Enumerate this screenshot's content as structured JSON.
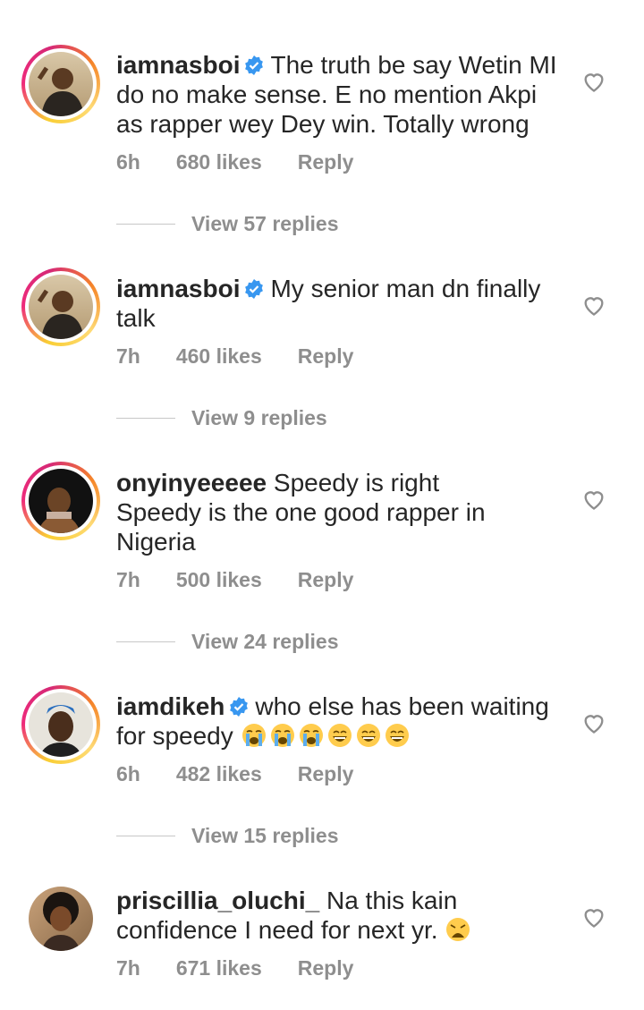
{
  "comments": [
    {
      "username": "iamnasboi",
      "verified": true,
      "text": "The truth be say Wetin MI do no make sense. E no mention Akpi as rapper wey Dey win. Totally wrong",
      "time": "6h",
      "likes": "680 likes",
      "reply": "Reply",
      "view_replies": "View 57 replies"
    },
    {
      "username": "iamnasboi",
      "verified": true,
      "text": "My senior man dn finally talk",
      "time": "7h",
      "likes": "460 likes",
      "reply": "Reply",
      "view_replies": "View 9 replies"
    },
    {
      "username": "onyinyeeeee",
      "verified": false,
      "text_line1": "Speedy is right",
      "text_line2": "Speedy is the one good rapper in Nigeria",
      "time": "7h",
      "likes": "500 likes",
      "reply": "Reply",
      "view_replies": "View 24 replies"
    },
    {
      "username": "iamdikeh",
      "verified": true,
      "text": "who else has been waiting for speedy",
      "emojis": [
        "loudly-crying-face",
        "loudly-crying-face",
        "loudly-crying-face",
        "grinning-sweat-face",
        "grinning-sweat-face",
        "grinning-sweat-face"
      ],
      "time": "6h",
      "likes": "482 likes",
      "reply": "Reply",
      "view_replies": "View 15 replies"
    },
    {
      "username": "priscillia_oluchi_",
      "verified": false,
      "text": "Na this kain confidence I need for next yr.",
      "emojis": [
        "weary-face"
      ],
      "time": "7h",
      "likes": "671 likes",
      "reply": "Reply"
    }
  ],
  "colors": {
    "text": "#262626",
    "meta": "#8e8e8e",
    "verified": "#3897f0",
    "emoji": "#ffcc4d"
  }
}
